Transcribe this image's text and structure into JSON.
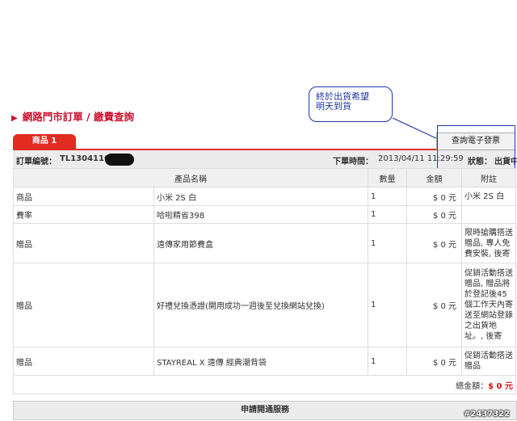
{
  "header": {
    "title": "網路門市訂單 / 繳費查詢"
  },
  "tab": {
    "label": "商品 1"
  },
  "invoice_button": "查詢電子發票",
  "annotation": {
    "line1": "終於出貨希望",
    "line2": "明天到貨"
  },
  "order": {
    "number_label": "訂單編號：",
    "number_value": "TL13041100",
    "time_label": "下單時間：",
    "time_value": "2013/04/11 11:29:59",
    "status_label": "狀態：",
    "status_value": "出貨中"
  },
  "table": {
    "headers": [
      "產品名稱",
      "數量",
      "金額",
      "附註"
    ],
    "rows": [
      {
        "type": "商品",
        "name": "小米 2S 白",
        "qty": "1",
        "amount": "$ 0 元",
        "note": "小米 2S 白"
      },
      {
        "type": "費率",
        "name": "哈啦精省398",
        "qty": "1",
        "amount": "$ 0 元",
        "note": ""
      },
      {
        "type": "贈品",
        "name": "遠傳家用節費盒",
        "qty": "1",
        "amount": "$ 0 元",
        "note": "限時搶購搭送贈品, 專人免費安裝, 後寄"
      },
      {
        "type": "贈品",
        "name": "好禮兌換憑證(開用成功一週後至兌換網站兌換)",
        "qty": "1",
        "amount": "$ 0 元",
        "note": "促銷活動搭送贈品, 贈品將於登記後45個工作天內寄送至網站登錄之出貨地址。, 後寄"
      },
      {
        "type": "贈品",
        "name": "STAYREAL X 遠傳 經典潮背袋",
        "qty": "1",
        "amount": "$ 0 元",
        "note": "促銷活動搭送贈品"
      }
    ],
    "total_label": "總金額：",
    "total_value": "$ 0 元"
  },
  "service": {
    "title": "申請開通服務"
  },
  "watermark": "#2437322",
  "colors": {
    "accent_red": "#e22b21",
    "annotation_blue": "#1f36a6"
  }
}
